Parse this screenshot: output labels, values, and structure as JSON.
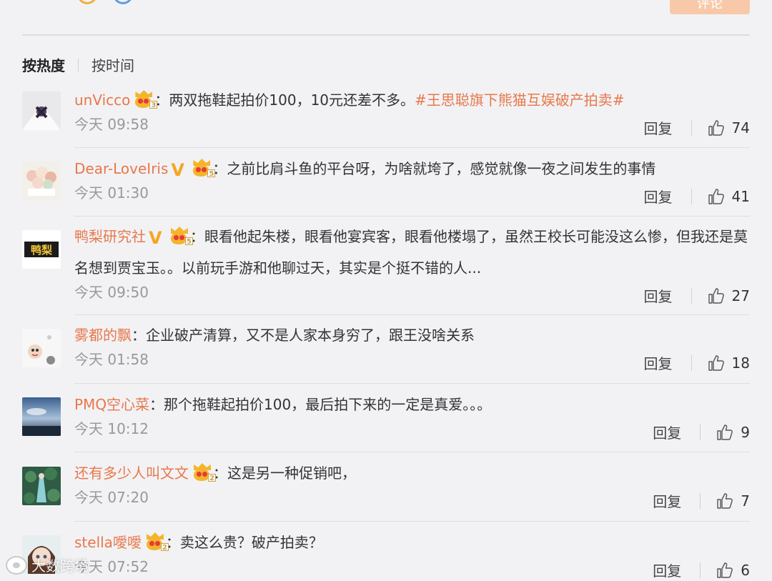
{
  "header": {
    "post_button_label": "评论"
  },
  "sort": {
    "hot": "按热度",
    "time": "按时间"
  },
  "actions": {
    "reply_label": "回复"
  },
  "comments": [
    {
      "username": "unVicco",
      "verified": false,
      "member_level": "3",
      "text_before": "：两双拖鞋起拍价100，10元还差不多。",
      "topic": "#王思聪旗下熊猫互娱破产拍卖#",
      "text_after": "",
      "time": "今天 09:58",
      "likes": "74"
    },
    {
      "username": "Dear-LoveIris",
      "verified": true,
      "member_level": "5",
      "text_before": "：之前比肩斗鱼的平台呀，为啥就垮了，感觉就像一夜之间发生的事情",
      "topic": "",
      "text_after": "",
      "time": "今天 01:30",
      "likes": "41"
    },
    {
      "username": "鸭梨研究社",
      "verified": true,
      "member_level": "5",
      "text_before": "：眼看他起朱楼，眼看他宴宾客，眼看他楼塌了，虽然王校长可能没这么惨，但我还是莫名想到贾宝玉。。以前玩手游和他聊过天，其实是个挺不错的人...",
      "topic": "",
      "text_after": "",
      "time": "今天 09:50",
      "likes": "27",
      "avatar_text": "鸭梨"
    },
    {
      "username": "雾都的飘",
      "verified": false,
      "member_level": "",
      "text_before": "：企业破产清算，又不是人家本身穷了，跟王没啥关系",
      "topic": "",
      "text_after": "",
      "time": "今天 01:58",
      "likes": "18"
    },
    {
      "username": "PMQ空心菜",
      "verified": false,
      "member_level": "",
      "text_before": "：那个拖鞋起拍价100，最后拍下来的一定是真爱。。。",
      "topic": "",
      "text_after": "",
      "time": "今天 10:12",
      "likes": "9"
    },
    {
      "username": "还有多少人叫文文",
      "verified": false,
      "member_level": "2",
      "text_before": "：这是另一种促销吧，",
      "topic": "",
      "text_after": "",
      "time": "今天 07:20",
      "likes": "7"
    },
    {
      "username": "stella噯噯",
      "verified": false,
      "member_level": "2",
      "text_before": "：卖这么贵？破产拍卖？",
      "topic": "",
      "text_after": "",
      "time": "今天 07:52",
      "likes": "6"
    }
  ],
  "watermark": {
    "text": "大数跨境"
  },
  "colors": {
    "accent": "#e8784a",
    "background": "#f2f2f5",
    "badge_gold": "#f5b52a"
  }
}
